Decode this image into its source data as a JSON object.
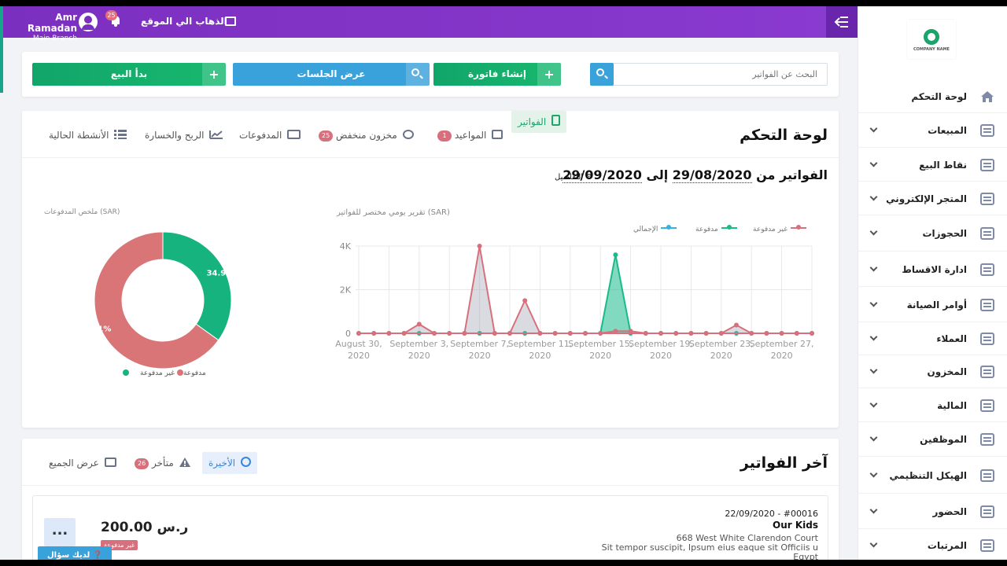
{
  "topbar": {
    "user_name": "Amr Ramadan",
    "branch": "Main Branch",
    "notifications": "25",
    "visit_site": "الذهاب الي الموقع"
  },
  "search": {
    "placeholder": "البحث عن الفواتير",
    "new_invoice": "إنشاء فاتورة",
    "sessions": "عرض الجلسات",
    "start_sale": "بدأ البيع"
  },
  "sidebar": {
    "company": "COMPANY NAME",
    "items": [
      {
        "label": "لوحة التحكم",
        "icon": "home-icon"
      },
      {
        "label": "المبيعات",
        "icon": "sales-icon"
      },
      {
        "label": "نقاط البيع",
        "icon": "pos-icon"
      },
      {
        "label": "المتجر الإلكتروني",
        "icon": "store-icon"
      },
      {
        "label": "الحجوزات",
        "icon": "calendar-icon"
      },
      {
        "label": "ادارة الاقساط",
        "icon": "installments-icon"
      },
      {
        "label": "أوامر الصيانة",
        "icon": "clipboard-icon"
      },
      {
        "label": "العملاء",
        "icon": "customers-icon"
      },
      {
        "label": "المخزون",
        "icon": "inventory-icon"
      },
      {
        "label": "المالية",
        "icon": "finance-icon"
      },
      {
        "label": "الموظفين",
        "icon": "employees-icon"
      },
      {
        "label": "الهيكل التنظيمي",
        "icon": "org-icon"
      },
      {
        "label": "الحضور",
        "icon": "attendance-icon"
      },
      {
        "label": "المرتبات",
        "icon": "salary-icon"
      }
    ]
  },
  "dashboard": {
    "title": "لوحة التحكم",
    "tabs": {
      "invoices": "الفواتير",
      "appointments": "المواعيد",
      "appointments_count": "1",
      "low_stock": "مخزون منخفض",
      "low_stock_count": "25",
      "payments": "المدفوعات",
      "profit": "الربح والخسارة",
      "activities": "الأنشطة الحالية"
    },
    "range_prefix": "الفواتير من",
    "range_from": "29/08/2020",
    "range_to_word": "إلى",
    "range_to": "29/09/2020",
    "details": "التفاصيل",
    "line_chart_title": "تقرير يومي مختصر للفواتير (SAR)",
    "donut_title": "ملخص المدفوعات (SAR)"
  },
  "latest": {
    "title": "آخر الفواتير",
    "tab_recent": "الأخيرة",
    "tab_overdue": "متأخر",
    "overdue_count": "26",
    "tab_all": "عرض الجميع",
    "invoice": {
      "number": "22/09/2020 - #00016",
      "client": "Our Kids",
      "addr1": "668 West White Clarendon Court",
      "addr2": "Sit tempor suscipit, Ipsum eius eaque sit Officiis u",
      "addr3": "Egypt",
      "amount": "200.00 ر.س",
      "status": "غير مدفوعة",
      "more": "..."
    }
  },
  "help": "لديك سؤال",
  "chart_data": [
    {
      "type": "area",
      "title": "تقرير يومي مختصر للفواتير (SAR)",
      "x_tick_labels": [
        "August 30, 2020",
        "September 3, 2020",
        "September 7, 2020",
        "September 11, 2020",
        "September 15, 2020",
        "September 19, 2020",
        "September 23, 2020",
        "September 27, 2020"
      ],
      "y_ticks": [
        "0",
        "2K",
        "4K"
      ],
      "ylim": [
        0,
        4000
      ],
      "x_points": 31,
      "series": [
        {
          "name": "غير مدفوعة",
          "color": "#d7707c",
          "values": [
            0,
            0,
            0,
            0,
            420,
            0,
            0,
            0,
            4000,
            0,
            0,
            1500,
            0,
            0,
            0,
            0,
            0,
            100,
            100,
            0,
            0,
            0,
            0,
            0,
            0,
            380,
            0,
            0,
            0,
            0,
            0
          ]
        },
        {
          "name": "مدفوعة",
          "color": "#1aba8a",
          "values": [
            0,
            0,
            0,
            0,
            0,
            0,
            0,
            0,
            0,
            0,
            0,
            0,
            0,
            0,
            0,
            0,
            0,
            3600,
            0,
            0,
            0,
            0,
            0,
            0,
            0,
            0,
            0,
            0,
            0,
            0,
            0
          ]
        },
        {
          "name": "الإجمالي",
          "color": "#35b3e0",
          "values": [
            0,
            0,
            0,
            0,
            420,
            0,
            0,
            0,
            4000,
            0,
            0,
            1500,
            0,
            0,
            0,
            0,
            0,
            3700,
            100,
            0,
            0,
            0,
            0,
            0,
            0,
            380,
            0,
            0,
            0,
            0,
            0
          ]
        }
      ],
      "legend": "top-right",
      "grid": true
    },
    {
      "type": "pie",
      "title": "ملخص المدفوعات (SAR)",
      "labels": [
        "مدفوعة",
        "غير مدفوعة"
      ],
      "values": [
        34.9,
        65.1
      ],
      "value_labels": [
        "34.9%",
        "65.1%"
      ],
      "colors": [
        "#16b37e",
        "#d97477"
      ]
    }
  ]
}
